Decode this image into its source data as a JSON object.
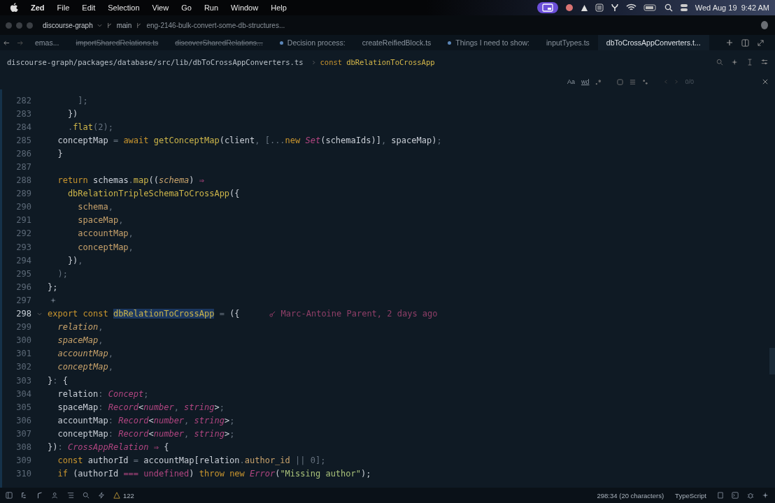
{
  "menu_bar": {
    "app": "Zed",
    "items": [
      "File",
      "Edit",
      "Selection",
      "View",
      "Go",
      "Run",
      "Window",
      "Help"
    ],
    "clock": "Wed Aug 19  9:42 AM"
  },
  "title_bar": {
    "project": "discourse-graph",
    "branch": "main",
    "branch_detail": "eng-2146-bulk-convert-some-db-structures..."
  },
  "tabs": [
    {
      "label": "emas...",
      "selected": false,
      "deleted": false,
      "modified": false
    },
    {
      "label": "importSharedRelations.ts",
      "selected": false,
      "deleted": true,
      "modified": false
    },
    {
      "label": "discoverSharedRelations...",
      "selected": false,
      "deleted": true,
      "modified": false
    },
    {
      "label": "Decision process:",
      "selected": false,
      "deleted": false,
      "modified": true
    },
    {
      "label": "createReifiedBlock.ts",
      "selected": false,
      "deleted": false,
      "modified": false
    },
    {
      "label": "Things I need to show:",
      "selected": false,
      "deleted": false,
      "modified": true
    },
    {
      "label": "inputTypes.ts",
      "selected": false,
      "deleted": false,
      "modified": false
    },
    {
      "label": "dbToCrossAppConverters.t...",
      "selected": true,
      "deleted": false,
      "modified": false
    }
  ],
  "breadcrumb": {
    "path": "discourse-graph/packages/database/src/lib/dbToCrossAppConverters.ts",
    "keyword": "const",
    "symbol": "dbRelationToCrossApp"
  },
  "search_bar": {
    "case_label": "Aa",
    "word_label": "wd",
    "count": "0/0"
  },
  "code_lines": [
    {
      "number": "282",
      "current": false,
      "tokens": [
        {
          "text": "      ];",
          "kind": "punct"
        }
      ]
    },
    {
      "number": "283",
      "current": false,
      "tokens": [
        {
          "text": "    })",
          "kind": "plain"
        }
      ]
    },
    {
      "number": "284",
      "current": false,
      "tokens": [
        {
          "text": "    .",
          "kind": "punct"
        },
        {
          "text": "flat",
          "kind": "fn"
        },
        {
          "text": "(2);",
          "kind": "punct"
        }
      ]
    },
    {
      "number": "285",
      "current": false,
      "tokens": [
        {
          "text": "  conceptMap ",
          "kind": "plain"
        },
        {
          "text": "= ",
          "kind": "punct"
        },
        {
          "text": "await ",
          "kind": "keyword"
        },
        {
          "text": "getConceptMap",
          "kind": "fn"
        },
        {
          "text": "(client",
          "kind": "plain"
        },
        {
          "text": ", [...",
          "kind": "punct"
        },
        {
          "text": "new ",
          "kind": "keyword"
        },
        {
          "text": "Set",
          "kind": "type"
        },
        {
          "text": "(schemaIds)]",
          "kind": "plain"
        },
        {
          "text": ", ",
          "kind": "punct"
        },
        {
          "text": "spaceMap)",
          "kind": "plain"
        },
        {
          "text": ";",
          "kind": "punct"
        }
      ]
    },
    {
      "number": "286",
      "current": false,
      "tokens": [
        {
          "text": "  }",
          "kind": "plain"
        }
      ]
    },
    {
      "number": "287",
      "current": false
    },
    {
      "number": "288",
      "current": false,
      "tokens": [
        {
          "text": "  return ",
          "kind": "keyword"
        },
        {
          "text": "schemas",
          "kind": "plain"
        },
        {
          "text": ".",
          "kind": "punct"
        },
        {
          "text": "map",
          "kind": "fn"
        },
        {
          "text": "((",
          "kind": "plain"
        },
        {
          "text": "schema",
          "kind": "param"
        },
        {
          "text": ") ",
          "kind": "plain"
        },
        {
          "text": "⇒",
          "kind": "arrow"
        }
      ]
    },
    {
      "number": "289",
      "current": false,
      "tokens": [
        {
          "text": "    dbRelationTripleSchemaToCrossApp",
          "kind": "fn"
        },
        {
          "text": "({",
          "kind": "plain"
        }
      ]
    },
    {
      "number": "290",
      "current": false,
      "tokens": [
        {
          "text": "      schema",
          "kind": "prop"
        },
        {
          "text": ",",
          "kind": "punct"
        }
      ]
    },
    {
      "number": "291",
      "current": false,
      "tokens": [
        {
          "text": "      spaceMap",
          "kind": "prop"
        },
        {
          "text": ",",
          "kind": "punct"
        }
      ]
    },
    {
      "number": "292",
      "current": false,
      "tokens": [
        {
          "text": "      accountMap",
          "kind": "prop"
        },
        {
          "text": ",",
          "kind": "punct"
        }
      ]
    },
    {
      "number": "293",
      "current": false,
      "tokens": [
        {
          "text": "      conceptMap",
          "kind": "prop"
        },
        {
          "text": ",",
          "kind": "punct"
        }
      ]
    },
    {
      "number": "294",
      "current": false,
      "tokens": [
        {
          "text": "    })",
          "kind": "plain"
        },
        {
          "text": ",",
          "kind": "punct"
        }
      ]
    },
    {
      "number": "295",
      "current": false,
      "tokens": [
        {
          "text": "  );",
          "kind": "punct"
        }
      ]
    },
    {
      "number": "296",
      "current": false,
      "tokens": [
        {
          "text": "};",
          "kind": "plain"
        }
      ]
    },
    {
      "number": "297",
      "current": false,
      "code_action": true
    },
    {
      "number": "298",
      "current": true,
      "expanded": true,
      "blame": "Marc-Antoine Parent, 2 days ago",
      "tokens": [
        {
          "text": "export ",
          "kind": "keyword"
        },
        {
          "text": "const ",
          "kind": "keyword"
        },
        {
          "text": "dbRelationToCrossApp",
          "kind": "selected"
        },
        {
          "text": " = ",
          "kind": "punct"
        },
        {
          "text": "({",
          "kind": "plain"
        }
      ]
    },
    {
      "number": "299",
      "current": false,
      "tokens": [
        {
          "text": "  relation",
          "kind": "param"
        },
        {
          "text": ",",
          "kind": "punct"
        }
      ]
    },
    {
      "number": "300",
      "current": false,
      "tokens": [
        {
          "text": "  spaceMap",
          "kind": "param"
        },
        {
          "text": ",",
          "kind": "punct"
        }
      ]
    },
    {
      "number": "301",
      "current": false,
      "tokens": [
        {
          "text": "  accountMap",
          "kind": "param"
        },
        {
          "text": ",",
          "kind": "punct"
        }
      ]
    },
    {
      "number": "302",
      "current": false,
      "tokens": [
        {
          "text": "  conceptMap",
          "kind": "param"
        },
        {
          "text": ",",
          "kind": "punct"
        }
      ]
    },
    {
      "number": "303",
      "current": false,
      "tokens": [
        {
          "text": "}",
          "kind": "plain"
        },
        {
          "text": ": ",
          "kind": "punct"
        },
        {
          "text": "{",
          "kind": "plain"
        }
      ]
    },
    {
      "number": "304",
      "current": false,
      "tokens": [
        {
          "text": "  relation",
          "kind": "plain"
        },
        {
          "text": ": ",
          "kind": "punct"
        },
        {
          "text": "Concept",
          "kind": "type"
        },
        {
          "text": ";",
          "kind": "punct"
        }
      ]
    },
    {
      "number": "305",
      "current": false,
      "tokens": [
        {
          "text": "  spaceMap",
          "kind": "plain"
        },
        {
          "text": ": ",
          "kind": "punct"
        },
        {
          "text": "Record",
          "kind": "type"
        },
        {
          "text": "<",
          "kind": "plain"
        },
        {
          "text": "number",
          "kind": "type"
        },
        {
          "text": ", ",
          "kind": "punct"
        },
        {
          "text": "string",
          "kind": "type"
        },
        {
          "text": ">",
          "kind": "plain"
        },
        {
          "text": ";",
          "kind": "punct"
        }
      ]
    },
    {
      "number": "306",
      "current": false,
      "tokens": [
        {
          "text": "  accountMap",
          "kind": "plain"
        },
        {
          "text": ": ",
          "kind": "punct"
        },
        {
          "text": "Record",
          "kind": "type"
        },
        {
          "text": "<",
          "kind": "plain"
        },
        {
          "text": "number",
          "kind": "type"
        },
        {
          "text": ", ",
          "kind": "punct"
        },
        {
          "text": "string",
          "kind": "type"
        },
        {
          "text": ">",
          "kind": "plain"
        },
        {
          "text": ";",
          "kind": "punct"
        }
      ]
    },
    {
      "number": "307",
      "current": false,
      "tokens": [
        {
          "text": "  conceptMap",
          "kind": "plain"
        },
        {
          "text": ": ",
          "kind": "punct"
        },
        {
          "text": "Record",
          "kind": "type"
        },
        {
          "text": "<",
          "kind": "plain"
        },
        {
          "text": "number",
          "kind": "type"
        },
        {
          "text": ", ",
          "kind": "punct"
        },
        {
          "text": "string",
          "kind": "type"
        },
        {
          "text": ">",
          "kind": "plain"
        },
        {
          "text": ";",
          "kind": "punct"
        }
      ]
    },
    {
      "number": "308",
      "current": false,
      "tokens": [
        {
          "text": "})",
          "kind": "plain"
        },
        {
          "text": ": ",
          "kind": "punct"
        },
        {
          "text": "CrossAppRelation",
          "kind": "type"
        },
        {
          "text": " ⇒",
          "kind": "arrow"
        },
        {
          "text": " {",
          "kind": "plain"
        }
      ]
    },
    {
      "number": "309",
      "current": false,
      "tokens": [
        {
          "text": "  const ",
          "kind": "keyword"
        },
        {
          "text": "authorId ",
          "kind": "plain"
        },
        {
          "text": "= ",
          "kind": "punct"
        },
        {
          "text": "accountMap[relation",
          "kind": "plain"
        },
        {
          "text": ".",
          "kind": "punct"
        },
        {
          "text": "author_id",
          "kind": "prop"
        },
        {
          "text": " || 0",
          "kind": "punct"
        },
        {
          "text": "];",
          "kind": "punct"
        }
      ]
    },
    {
      "number": "310",
      "current": false,
      "tokens": [
        {
          "text": "  if ",
          "kind": "keyword"
        },
        {
          "text": "(authorId ",
          "kind": "plain"
        },
        {
          "text": "=== ",
          "kind": "arrow"
        },
        {
          "text": "undefined",
          "kind": "type2"
        },
        {
          "text": ") ",
          "kind": "plain"
        },
        {
          "text": "throw ",
          "kind": "keyword"
        },
        {
          "text": "new ",
          "kind": "keyword"
        },
        {
          "text": "Error",
          "kind": "type"
        },
        {
          "text": "(",
          "kind": "plain"
        },
        {
          "text": "\"Missing author\"",
          "kind": "string"
        },
        {
          "text": ");",
          "kind": "plain"
        }
      ]
    }
  ],
  "status_bar": {
    "warnings": "122",
    "position": "298:34 (20 characters)",
    "language": "TypeScript"
  }
}
